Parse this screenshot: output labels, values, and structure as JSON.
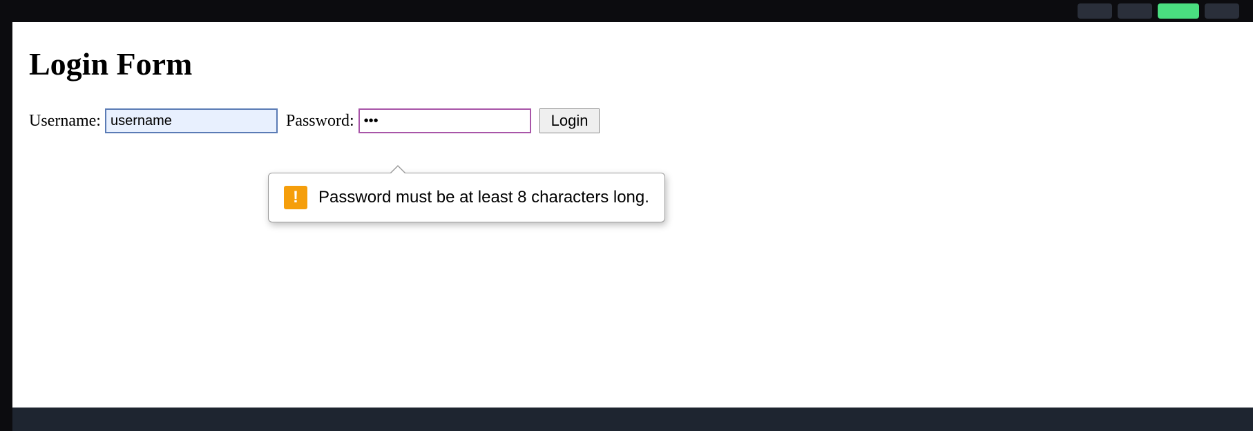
{
  "page": {
    "title": "Login Form"
  },
  "form": {
    "username_label": "Username:",
    "username_value": "username",
    "password_label": "Password:",
    "password_value": "•••",
    "login_button_label": "Login"
  },
  "validation": {
    "message": "Password must be at least 8 characters long.",
    "icon_glyph": "!"
  }
}
